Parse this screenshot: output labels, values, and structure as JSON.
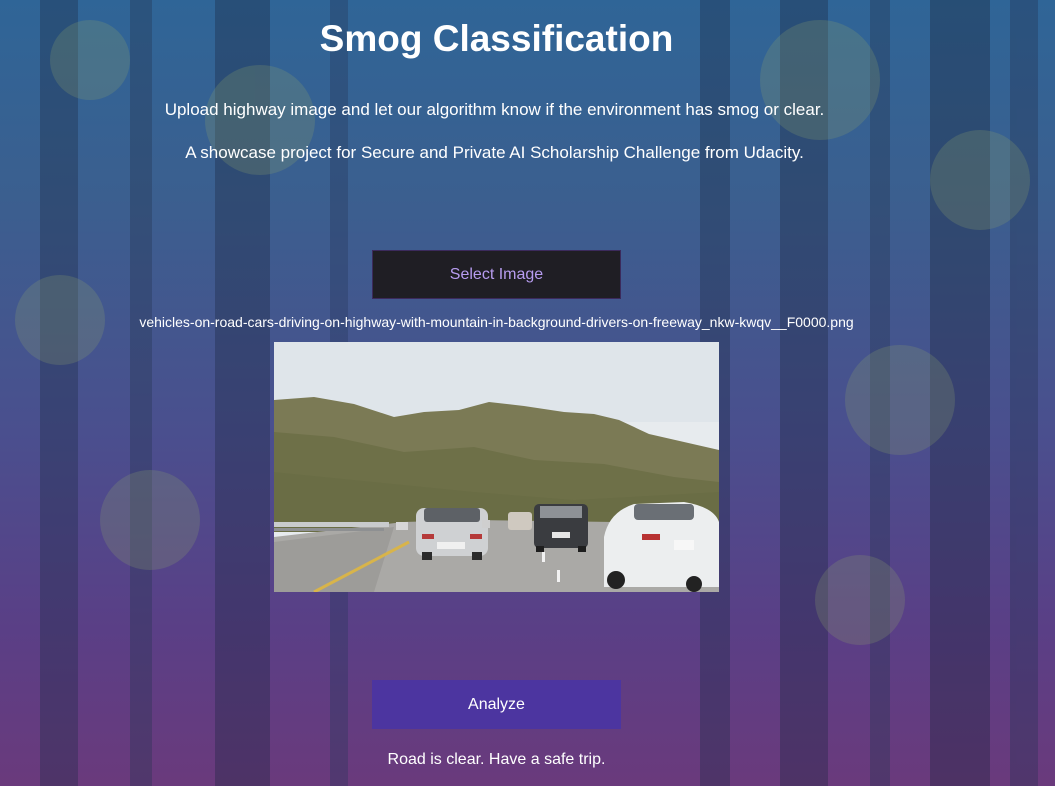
{
  "page": {
    "title": "Smog Classification",
    "subtitle_line1": "Upload highway image and let our algorithm know if the environment has smog or clear.",
    "subtitle_line2": "A showcase project for Secure and Private AI Scholarship Challenge from Udacity."
  },
  "upload": {
    "select_label": "Select Image",
    "filename": "vehicles-on-road-cars-driving-on-highway-with-mountain-in-background-drivers-on-freeway_nkw-kwqv__F0000.png"
  },
  "analyze": {
    "button_label": "Analyze",
    "result_text": "Road is clear. Have a safe trip."
  },
  "colors": {
    "select_button_bg": "#1f1e24",
    "select_button_text": "#b79cf0",
    "analyze_button_bg": "#4c35a0"
  }
}
